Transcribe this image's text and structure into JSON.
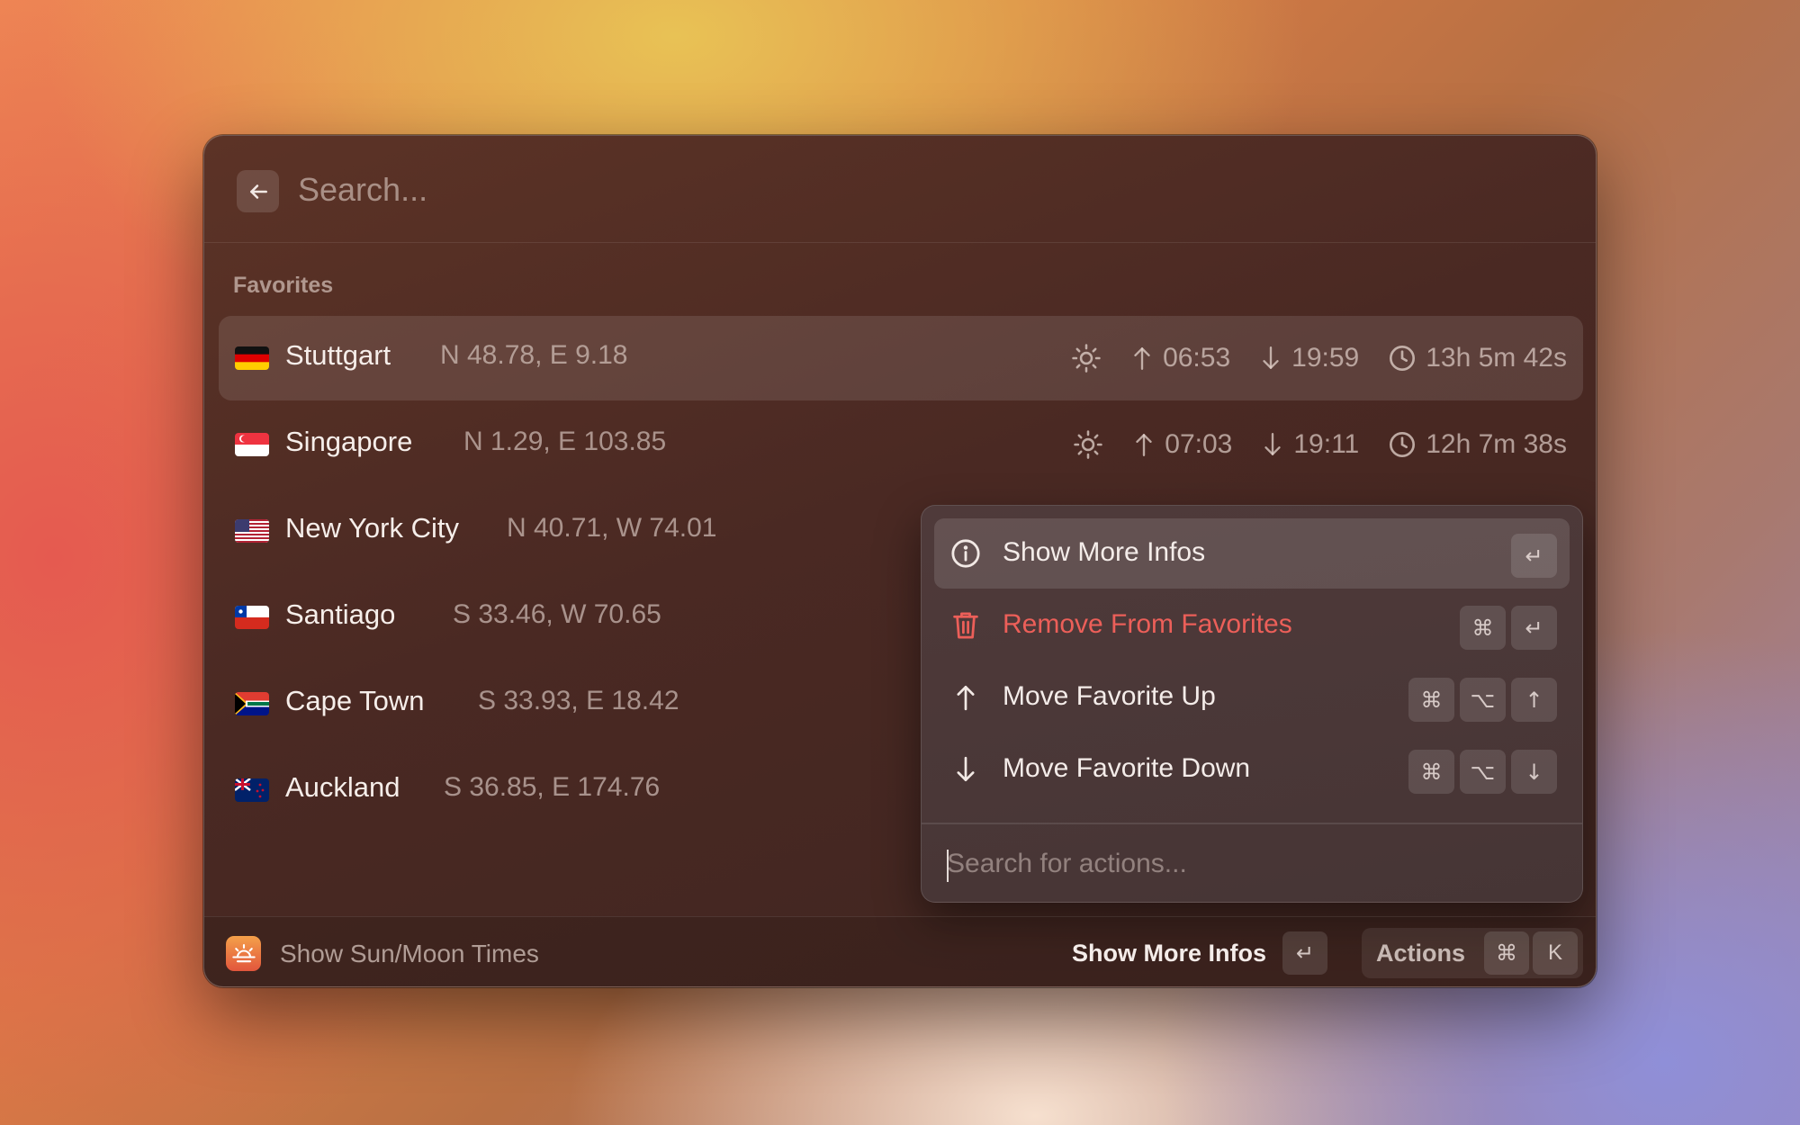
{
  "search": {
    "placeholder": "Search..."
  },
  "section": {
    "title": "Favorites"
  },
  "favorites": [
    {
      "flag": "germany",
      "city": "Stuttgart",
      "coords": "N 48.78, E 9.18",
      "sunrise": "06:53",
      "sunset": "19:59",
      "daylength": "13h 5m 42s"
    },
    {
      "flag": "singapore",
      "city": "Singapore",
      "coords": "N 1.29, E 103.85",
      "sunrise": "07:03",
      "sunset": "19:11",
      "daylength": "12h 7m 38s"
    },
    {
      "flag": "usa",
      "city": "New York City",
      "coords": "N 40.71, W 74.01"
    },
    {
      "flag": "chile",
      "city": "Santiago",
      "coords": "S 33.46, W 70.65"
    },
    {
      "flag": "south-africa",
      "city": "Cape Town",
      "coords": "S 33.93, E 18.42"
    },
    {
      "flag": "new-zealand",
      "city": "Auckland",
      "coords": "S 36.85, E 174.76"
    }
  ],
  "action_panel": {
    "items": [
      {
        "label": "Show More Infos",
        "icon": "info-icon",
        "keys": [
          "↵"
        ]
      },
      {
        "label": "Remove From Favorites",
        "icon": "trash-icon",
        "keys": [
          "⌘",
          "↵"
        ],
        "color": "#ec5f59"
      },
      {
        "label": "Move Favorite Up",
        "icon": "arrow-up-icon",
        "keys": [
          "⌘",
          "⌥",
          "↑"
        ]
      },
      {
        "label": "Move Favorite Down",
        "icon": "arrow-down-icon",
        "keys": [
          "⌘",
          "⌥",
          "↓"
        ]
      }
    ],
    "search_placeholder": "Search for actions..."
  },
  "footer": {
    "command_title": "Show Sun/Moon Times",
    "primary_action": "Show More Infos",
    "primary_key": "↵",
    "actions_label": "Actions",
    "actions_keys": [
      "⌘",
      "K"
    ]
  },
  "colors": {
    "danger": "#ec5f59",
    "window_bg": "#4a2923",
    "app_icon": "#e2563c"
  }
}
